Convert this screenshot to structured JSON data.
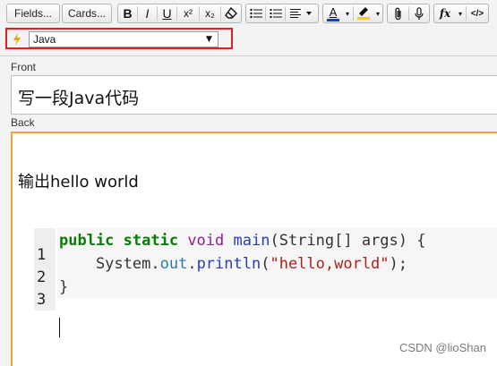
{
  "toolbar": {
    "fields_label": "Fields...",
    "cards_label": "Cards...",
    "bold_label": "B",
    "italic_label": "I",
    "underline_label": "U",
    "superscript_label": "x²",
    "subscript_label": "x₂",
    "eraser_icon": "eraser-icon",
    "bullet_list_icon": "bullet-list-icon",
    "numbered_list_icon": "numbered-list-icon",
    "align_icon": "align-icon",
    "text_color_label": "A",
    "highlight_icon": "highlight-icon",
    "attach_icon": "paperclip-icon",
    "record_icon": "microphone-icon",
    "math_label": "fx",
    "html_label": "</>"
  },
  "code_language": {
    "selected": "Java",
    "icon": "code-block-icon"
  },
  "fields": {
    "front": {
      "label": "Front",
      "value": "写一段Java代码"
    },
    "back": {
      "label": "Back",
      "intro": "输出hello world",
      "line_numbers": [
        "1",
        "2",
        "3"
      ],
      "code": {
        "l1_kw": "public static",
        "l1_type": "void",
        "l1_fn": "main",
        "l1_rest": "(String[] args) {",
        "l2_obj": "    System.",
        "l2_prop": "out",
        "l2_dot": ".",
        "l2_fn": "println",
        "l2_open": "(",
        "l2_str": "\"hello,world\"",
        "l2_close": ");",
        "l3": "}"
      }
    }
  },
  "colors": {
    "text_color_bar": "#1a3fbf",
    "highlight_bar": "#f5d300",
    "focus_border": "#f2a23c",
    "annotation_box": "#e02020"
  },
  "watermark": "CSDN @lioShan"
}
